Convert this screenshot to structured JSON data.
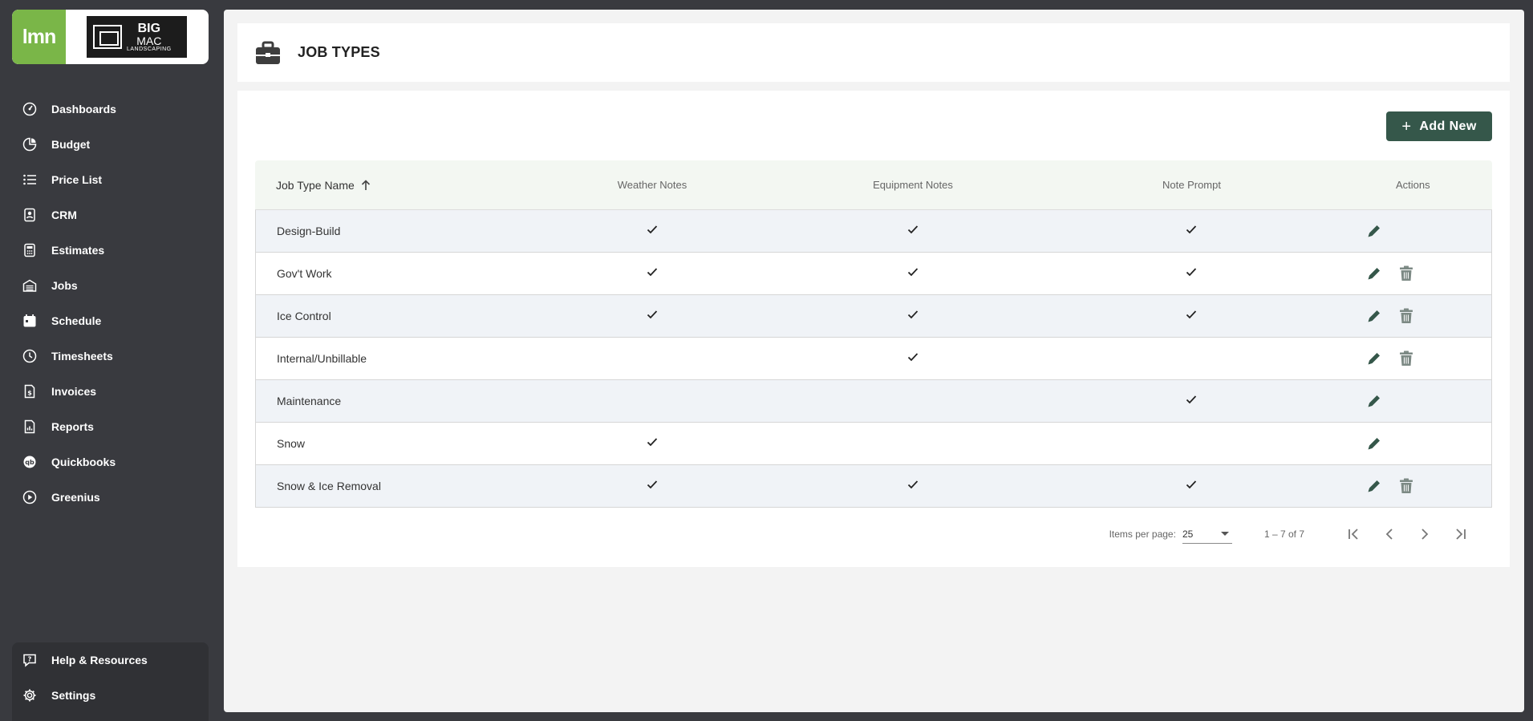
{
  "brand": {
    "app_logo": "lmn",
    "company_logo_big": "BIG",
    "company_logo_mac": "MAC",
    "company_logo_sub": "LANDSCAPING",
    "accent": "#7ab648",
    "primary": "#35574a"
  },
  "sidebar": {
    "items": [
      {
        "label": "Dashboards",
        "icon": "dashboard-gauge-icon"
      },
      {
        "label": "Budget",
        "icon": "pie-chart-icon"
      },
      {
        "label": "Price List",
        "icon": "list-icon"
      },
      {
        "label": "CRM",
        "icon": "contact-card-icon"
      },
      {
        "label": "Estimates",
        "icon": "calculator-icon"
      },
      {
        "label": "Jobs",
        "icon": "garage-icon"
      },
      {
        "label": "Schedule",
        "icon": "calendar-icon"
      },
      {
        "label": "Timesheets",
        "icon": "clock-icon"
      },
      {
        "label": "Invoices",
        "icon": "invoice-dollar-icon"
      },
      {
        "label": "Reports",
        "icon": "report-icon"
      },
      {
        "label": "Quickbooks",
        "icon": "quickbooks-icon"
      },
      {
        "label": "Greenius",
        "icon": "play-circle-icon"
      }
    ],
    "bottom": [
      {
        "label": "Help & Resources",
        "icon": "help-icon"
      },
      {
        "label": "Settings",
        "icon": "gear-icon"
      }
    ]
  },
  "header": {
    "title": "JOB TYPES"
  },
  "toolbar": {
    "add_label": "Add New"
  },
  "table": {
    "columns": {
      "name": "Job Type Name",
      "weather": "Weather Notes",
      "equipment": "Equipment Notes",
      "note": "Note Prompt",
      "actions": "Actions"
    },
    "rows": [
      {
        "name": "Design-Build",
        "weather": true,
        "equipment": true,
        "note": true,
        "deletable": false
      },
      {
        "name": "Gov't Work",
        "weather": true,
        "equipment": true,
        "note": true,
        "deletable": true
      },
      {
        "name": "Ice Control",
        "weather": true,
        "equipment": true,
        "note": true,
        "deletable": true
      },
      {
        "name": "Internal/Unbillable",
        "weather": false,
        "equipment": true,
        "note": false,
        "deletable": true
      },
      {
        "name": "Maintenance",
        "weather": false,
        "equipment": false,
        "note": true,
        "deletable": false
      },
      {
        "name": "Snow",
        "weather": true,
        "equipment": false,
        "note": false,
        "deletable": false
      },
      {
        "name": "Snow & Ice Removal",
        "weather": true,
        "equipment": true,
        "note": true,
        "deletable": true
      }
    ]
  },
  "pager": {
    "items_label": "Items per page:",
    "page_size": "25",
    "range": "1 – 7 of 7"
  }
}
